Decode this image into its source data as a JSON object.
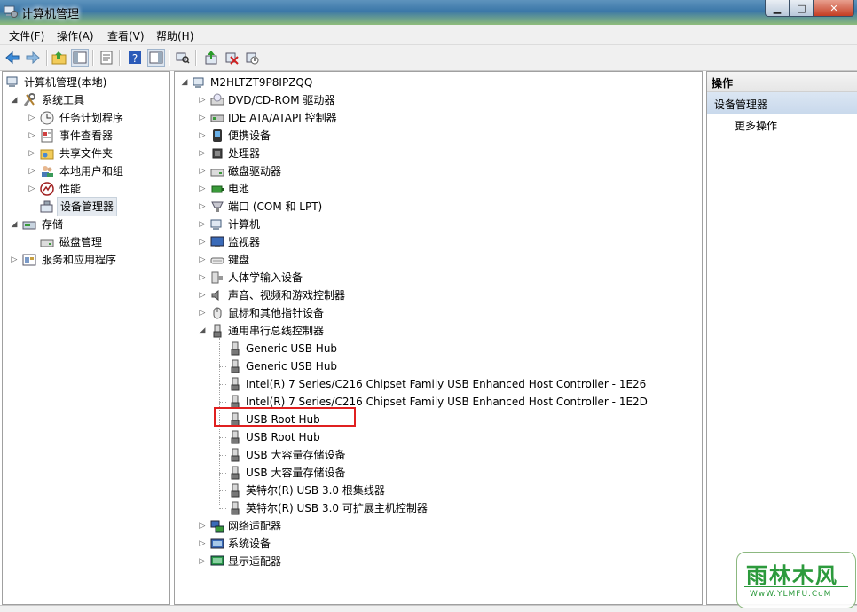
{
  "window": {
    "title": "计算机管理"
  },
  "menu": [
    "文件(F)",
    "操作(A)",
    "查看(V)",
    "帮助(H)"
  ],
  "left_tree": {
    "root": "计算机管理(本地)",
    "system_tools": "系统工具",
    "system_children": [
      "任务计划程序",
      "事件查看器",
      "共享文件夹",
      "本地用户和组",
      "性能",
      "设备管理器"
    ],
    "storage": "存储",
    "storage_children": [
      "磁盘管理"
    ],
    "services": "服务和应用程序"
  },
  "device_tree": {
    "computer": "M2HLTZT9P8IPZQQ",
    "categories_top": [
      "DVD/CD-ROM 驱动器",
      "IDE ATA/ATAPI 控制器",
      "便携设备",
      "处理器",
      "磁盘驱动器",
      "电池",
      "端口 (COM 和 LPT)",
      "计算机",
      "监视器",
      "键盘",
      "人体学输入设备",
      "声音、视频和游戏控制器",
      "鼠标和其他指针设备"
    ],
    "usb_category": "通用串行总线控制器",
    "usb_devices": [
      "Generic USB Hub",
      "Generic USB Hub",
      "Intel(R) 7 Series/C216 Chipset Family USB Enhanced Host Controller - 1E26",
      "Intel(R) 7 Series/C216 Chipset Family USB Enhanced Host Controller - 1E2D",
      "USB Root Hub",
      "USB Root Hub",
      "USB 大容量存储设备",
      "USB 大容量存储设备",
      "英特尔(R) USB 3.0 根集线器",
      "英特尔(R) USB 3.0 可扩展主机控制器"
    ],
    "categories_bottom": [
      "网络适配器",
      "系统设备",
      "显示适配器"
    ]
  },
  "actions": {
    "header": "操作",
    "section": "设备管理器",
    "more": "更多操作"
  },
  "watermark": {
    "main": "雨林木风",
    "sub": "WwW.YLMFU.CoM"
  },
  "colors": {
    "highlight": "#e02020",
    "selection_bg": "#e5eaf0",
    "action_section": "#c9d9ec",
    "watermark": "#2c9a3c"
  }
}
